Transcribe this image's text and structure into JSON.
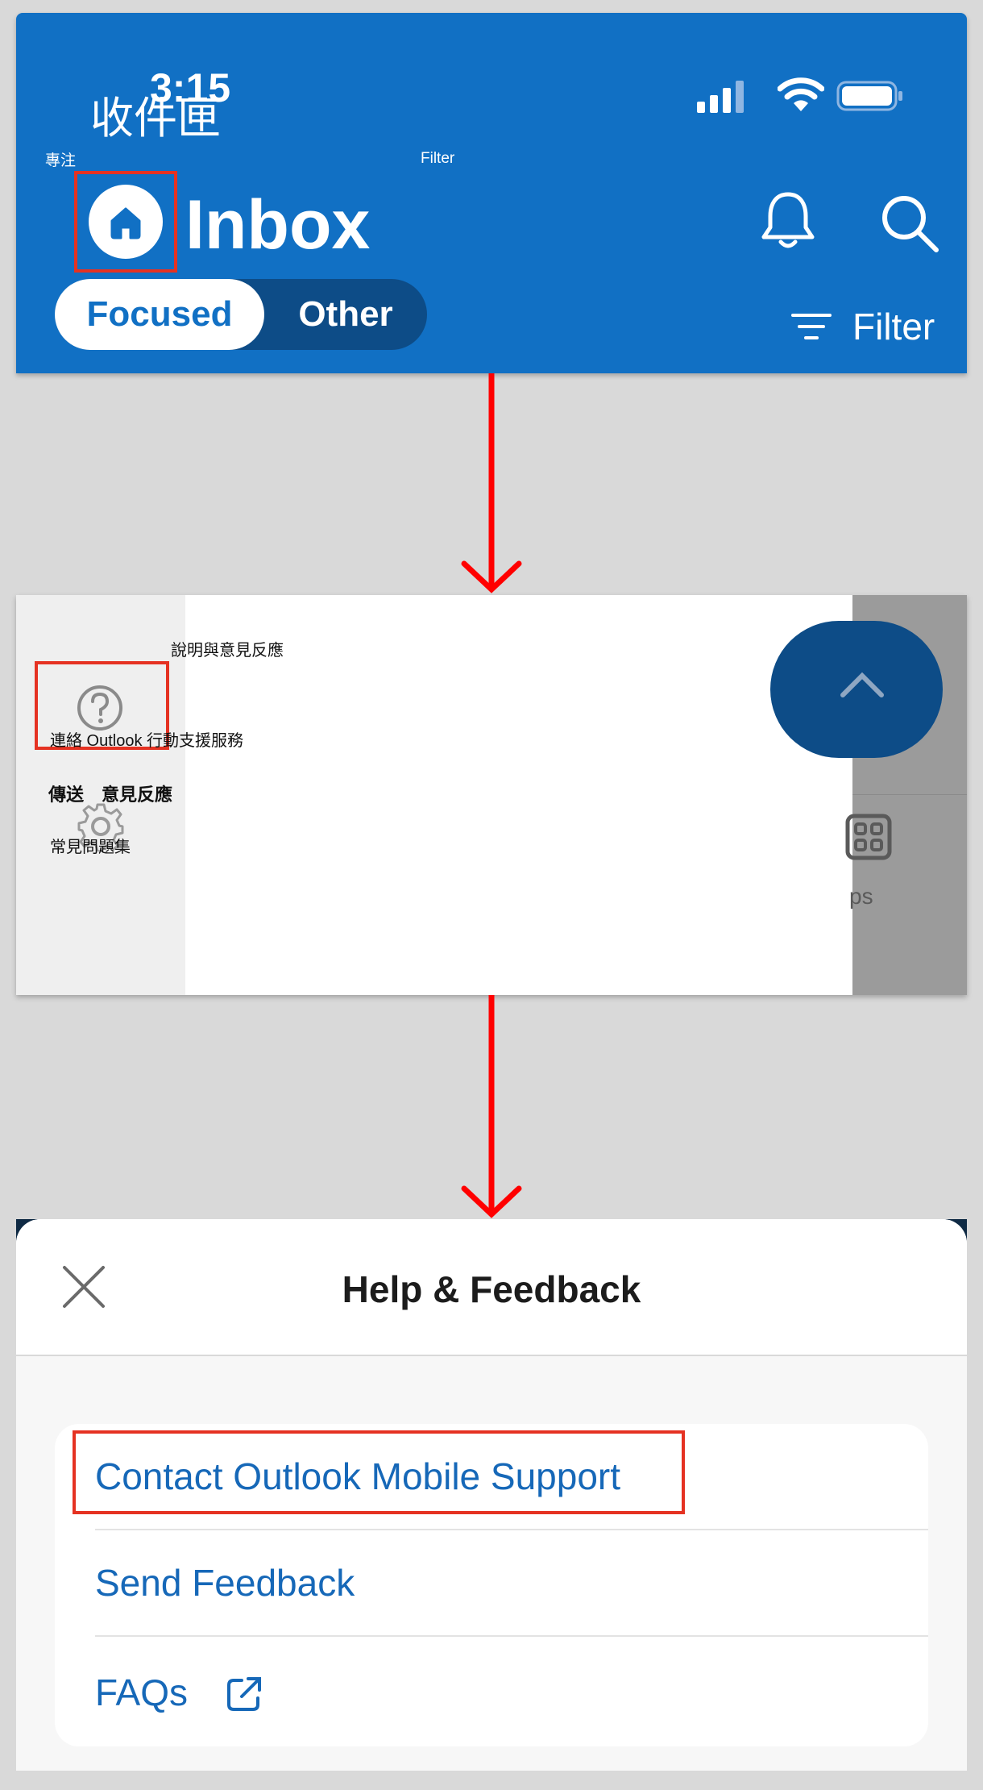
{
  "panel1": {
    "status_time": "3:15",
    "overlay_title": "收件匣",
    "focus_hint": "專注",
    "filter_hint": "Filter",
    "inbox_title": "Inbox",
    "tab_focused": "Focused",
    "tab_other": "Other",
    "filter_label": "Filter"
  },
  "panel2": {
    "help_label": "說明與意見反應",
    "contact_label": "連絡 Outlook 行動支援服務",
    "send_label": "傳送　意見反應",
    "faq_label": "常見問題集",
    "apps_label": "ps"
  },
  "panel3": {
    "title": "Help & Feedback",
    "items": [
      {
        "label": "Contact Outlook Mobile Support"
      },
      {
        "label": "Send Feedback"
      },
      {
        "label": "FAQs"
      }
    ]
  },
  "colors": {
    "outlook_blue": "#1170c4",
    "link_blue": "#1668b8",
    "highlight_red": "#e53222",
    "arrow_red": "#ff0000"
  }
}
